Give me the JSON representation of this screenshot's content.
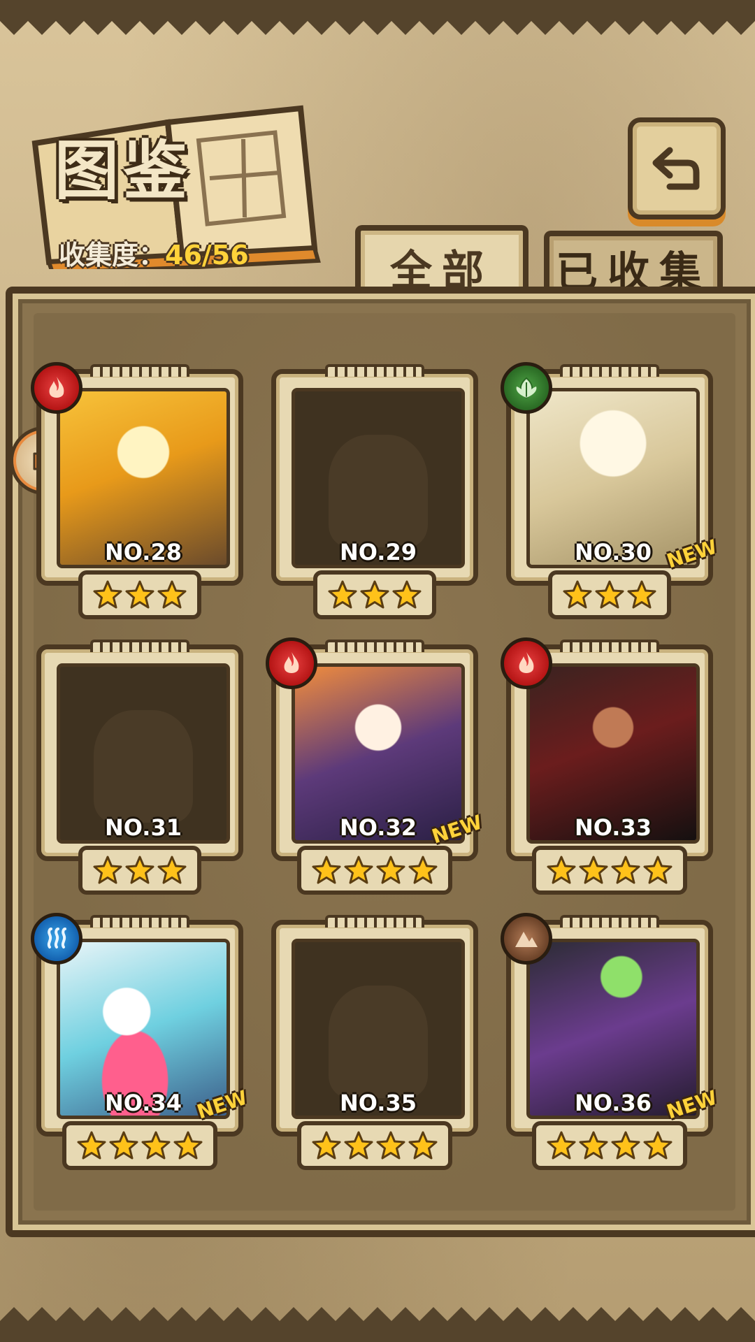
{
  "header": {
    "title": "图鉴",
    "collection_label": "收集度：",
    "collection_value": "46/56"
  },
  "tabs": [
    {
      "label": "全部",
      "selected": true
    },
    {
      "label": "已收集",
      "selected": false
    }
  ],
  "colors": {
    "fire": "#c51f1f",
    "wood": "#2f7a2a",
    "water": "#1a74c4",
    "earth": "#7a4a2c",
    "star": "#ffc21a",
    "new_badge": "#ffd23a"
  },
  "cards": [
    {
      "number": "NO.28",
      "stars": 3,
      "element": "fire-icon",
      "collected": true,
      "new": false
    },
    {
      "number": "NO.29",
      "stars": 3,
      "element": null,
      "collected": false,
      "new": false
    },
    {
      "number": "NO.30",
      "stars": 3,
      "element": "leaf-icon",
      "collected": true,
      "new": true,
      "new_label": "NEW"
    },
    {
      "number": "NO.31",
      "stars": 3,
      "element": null,
      "collected": false,
      "new": false
    },
    {
      "number": "NO.32",
      "stars": 4,
      "element": "fire-icon",
      "collected": true,
      "new": true,
      "new_label": "NEW"
    },
    {
      "number": "NO.33",
      "stars": 4,
      "element": "fire-icon",
      "collected": true,
      "new": false
    },
    {
      "number": "NO.34",
      "stars": 4,
      "element": "water-icon",
      "collected": true,
      "new": true,
      "new_label": "NEW"
    },
    {
      "number": "NO.35",
      "stars": 4,
      "element": null,
      "collected": false,
      "new": false
    },
    {
      "number": "NO.36",
      "stars": 4,
      "element": "earth-icon",
      "collected": true,
      "new": true,
      "new_label": "NEW"
    }
  ]
}
